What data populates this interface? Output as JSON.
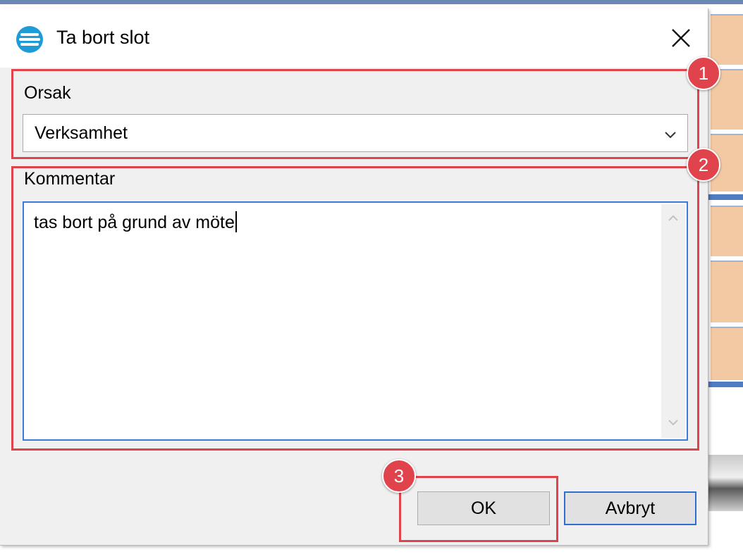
{
  "dialog": {
    "title": "Ta bort slot",
    "icon": "app-logo-icon",
    "close_icon": "close-icon"
  },
  "reason": {
    "label": "Orsak",
    "selected": "Verksamhet"
  },
  "comment": {
    "label": "Kommentar",
    "value": "tas bort på grund av möte"
  },
  "buttons": {
    "ok": "OK",
    "cancel": "Avbryt"
  },
  "annotations": {
    "badges": [
      "1",
      "2",
      "3"
    ],
    "color": "#e0434b"
  },
  "colors": {
    "focus_border": "#3a7bd5",
    "dialog_bg": "#f0f0f0",
    "background_cells": "#f2c9a3"
  }
}
